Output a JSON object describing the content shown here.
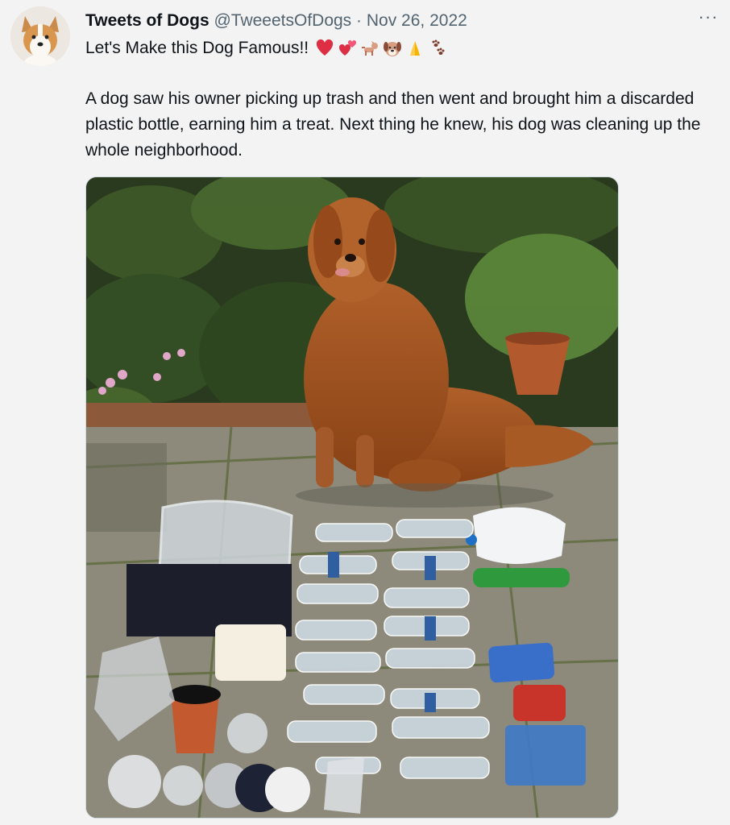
{
  "tweet": {
    "author_name": "Tweets of Dogs",
    "handle": "@TweeetsOfDogs",
    "separator": "·",
    "date": "Nov 26, 2022",
    "more_label": "···",
    "tagline": "Let's Make this Dog Famous!!",
    "tagline_emojis": [
      "red-heart",
      "two-hearts",
      "dog",
      "dog-face",
      "folded-hands",
      "paw-prints"
    ],
    "body": "A dog saw his owner picking up trash and then went and brought him a discarded plastic bottle, earning him a treat. Next thing he knew, his dog was cleaning up the whole neighborhood.",
    "media": {
      "description_icon": "photo",
      "subject": "golden retriever with collected plastic trash"
    }
  },
  "colors": {
    "text": "#0f1419",
    "secondary": "#536471",
    "background": "#f3f3f3"
  }
}
